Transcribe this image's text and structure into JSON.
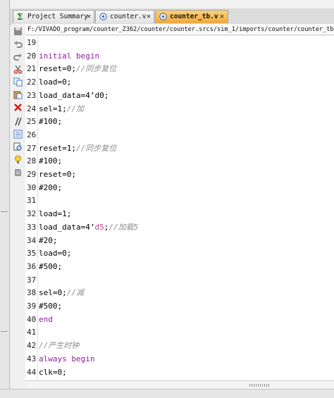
{
  "tabs": [
    {
      "label": "Project Summary",
      "icon": "sigma-icon",
      "close": "✕",
      "active": false
    },
    {
      "label": "counter.v",
      "icon": "verilog-file-icon",
      "close": "✕",
      "active": false
    },
    {
      "label": "counter_tb.v",
      "icon": "verilog-file-icon",
      "close": "✕",
      "active": true
    }
  ],
  "file_path": "F:/VIVADO_program/counter_Z362/counter/counter.srcs/sim_1/imports/counter/counter_tb.v",
  "toolbar_icons": [
    "save-icon",
    "undo-icon",
    "redo-icon",
    "cut-icon",
    "copy-icon",
    "paste-icon",
    "delete-icon",
    "comment-icon",
    "select-all-icon",
    "find-icon",
    "hint-icon",
    "insert-template-icon"
  ],
  "code_lines": [
    {
      "n": "19",
      "segs": []
    },
    {
      "n": "20",
      "segs": [
        {
          "t": "initial begin",
          "c": "kw"
        }
      ]
    },
    {
      "n": "21",
      "segs": [
        {
          "t": "reset=0;",
          "c": ""
        },
        {
          "t": "//同步复位",
          "c": "cm"
        }
      ]
    },
    {
      "n": "22",
      "segs": [
        {
          "t": "load=0;",
          "c": ""
        }
      ]
    },
    {
      "n": "23",
      "segs": [
        {
          "t": "load_data=4’d0;",
          "c": ""
        }
      ]
    },
    {
      "n": "24",
      "segs": [
        {
          "t": "sel=1;",
          "c": ""
        },
        {
          "t": "//加",
          "c": "cm"
        }
      ]
    },
    {
      "n": "25",
      "segs": [
        {
          "t": "#100;",
          "c": ""
        }
      ]
    },
    {
      "n": "26",
      "segs": []
    },
    {
      "n": "27",
      "segs": [
        {
          "t": "reset=1;",
          "c": ""
        },
        {
          "t": "//同步复位",
          "c": "cm"
        }
      ]
    },
    {
      "n": "28",
      "segs": [
        {
          "t": "#100;",
          "c": ""
        }
      ]
    },
    {
      "n": "29",
      "segs": [
        {
          "t": "reset=0;",
          "c": ""
        }
      ]
    },
    {
      "n": "30",
      "segs": [
        {
          "t": "#200;",
          "c": ""
        }
      ]
    },
    {
      "n": "31",
      "segs": []
    },
    {
      "n": "32",
      "segs": [
        {
          "t": "load=1;",
          "c": ""
        }
      ]
    },
    {
      "n": "33",
      "segs": [
        {
          "t": "load_data=4’",
          "c": ""
        },
        {
          "t": "d5",
          "c": "num"
        },
        {
          "t": ";",
          "c": ""
        },
        {
          "t": "//加载5",
          "c": "cm"
        }
      ]
    },
    {
      "n": "34",
      "segs": [
        {
          "t": "#20;",
          "c": ""
        }
      ]
    },
    {
      "n": "35",
      "segs": [
        {
          "t": "load=0;",
          "c": ""
        }
      ]
    },
    {
      "n": "36",
      "segs": [
        {
          "t": "#500;",
          "c": ""
        }
      ]
    },
    {
      "n": "37",
      "segs": []
    },
    {
      "n": "38",
      "segs": [
        {
          "t": "sel=0;",
          "c": ""
        },
        {
          "t": "//减",
          "c": "cm"
        }
      ]
    },
    {
      "n": "39",
      "segs": [
        {
          "t": "#500;",
          "c": ""
        }
      ]
    },
    {
      "n": "40",
      "segs": [
        {
          "t": "end",
          "c": "kw"
        }
      ]
    },
    {
      "n": "41",
      "segs": []
    },
    {
      "n": "42",
      "segs": [
        {
          "t": "//产生时钟",
          "c": "cm"
        }
      ]
    },
    {
      "n": "43",
      "segs": [
        {
          "t": "always begin",
          "c": "kw"
        }
      ]
    },
    {
      "n": "44",
      "segs": [
        {
          "t": "clk=0;",
          "c": ""
        }
      ]
    }
  ]
}
